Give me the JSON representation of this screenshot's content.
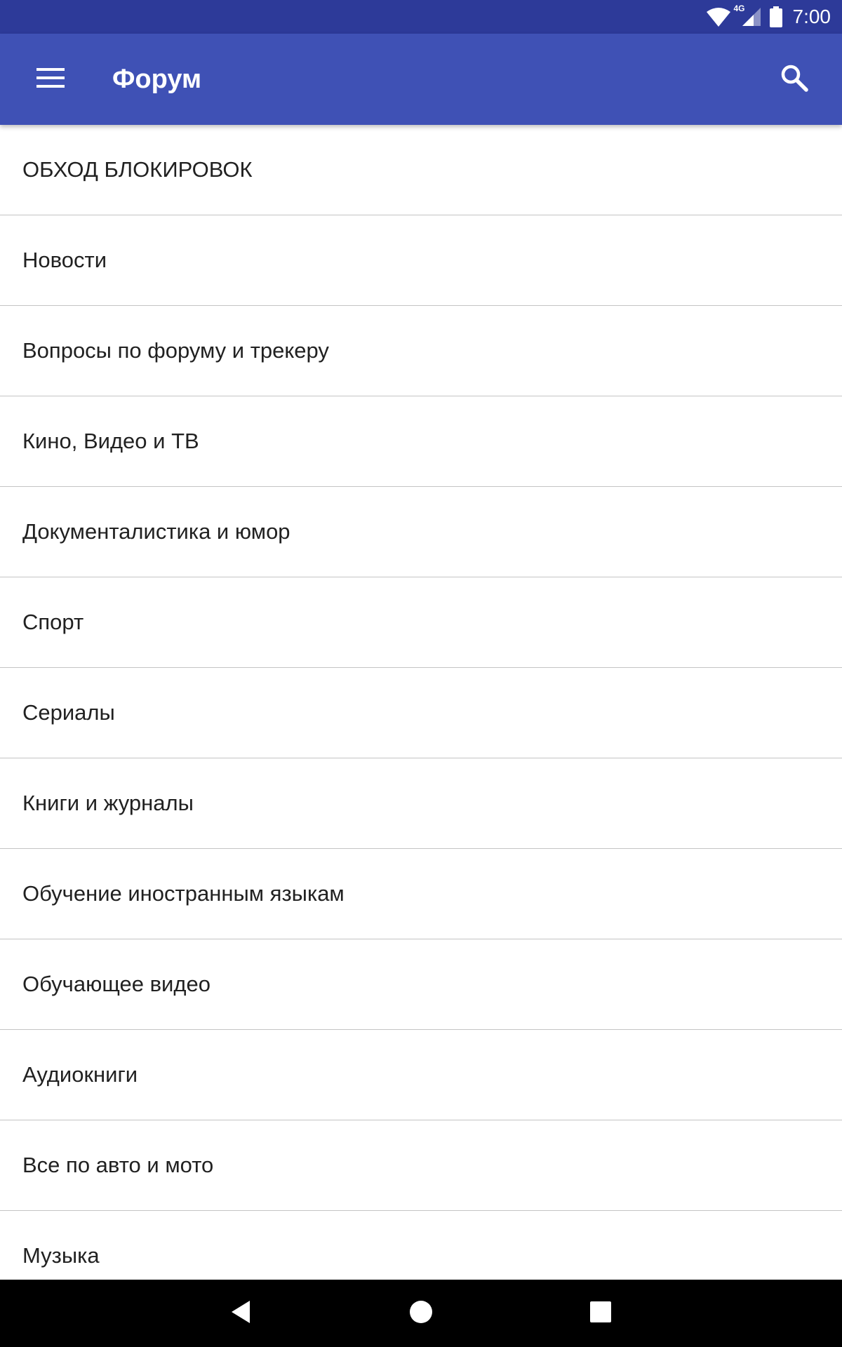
{
  "status_bar": {
    "network_label": "4G",
    "time": "7:00",
    "icons": [
      "wifi-icon",
      "cell-signal-icon",
      "battery-icon"
    ]
  },
  "app_bar": {
    "title": "Форум",
    "menu_icon": "hamburger-menu-icon",
    "search_icon": "search-icon",
    "color": "#3f51b5",
    "status_color": "#2d3a99"
  },
  "forum_list": {
    "items": [
      {
        "label": "ОБХОД БЛОКИРОВОК"
      },
      {
        "label": "Новости"
      },
      {
        "label": "Вопросы по форуму и трекеру"
      },
      {
        "label": "Кино, Видео и ТВ"
      },
      {
        "label": "Документалистика и юмор"
      },
      {
        "label": "Спорт"
      },
      {
        "label": "Сериалы"
      },
      {
        "label": "Книги и журналы"
      },
      {
        "label": "Обучение иностранным языкам"
      },
      {
        "label": "Обучающее видео"
      },
      {
        "label": "Аудиокниги"
      },
      {
        "label": "Все по авто и мото"
      },
      {
        "label": "Музыка"
      }
    ]
  },
  "nav_bar": {
    "icons": [
      "back-icon",
      "home-icon",
      "recents-icon"
    ]
  }
}
